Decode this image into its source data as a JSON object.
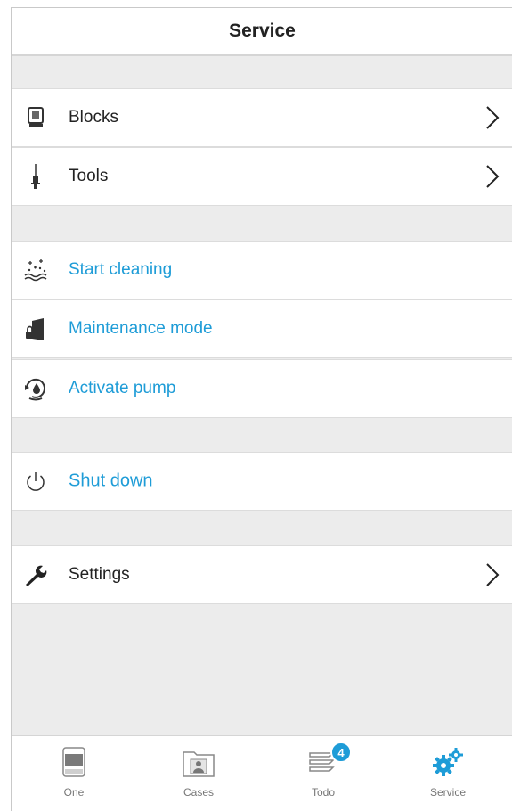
{
  "header": {
    "title": "Service"
  },
  "menu": {
    "blocks": {
      "label": "Blocks",
      "icon": "block-cassette-icon"
    },
    "tools": {
      "label": "Tools",
      "icon": "tool-needle-icon"
    },
    "start_cleaning": {
      "label": "Start cleaning",
      "icon": "cleaning-sparkle-icon"
    },
    "maintenance_mode": {
      "label": "Maintenance mode",
      "icon": "maintenance-lock-icon"
    },
    "activate_pump": {
      "label": "Activate pump",
      "icon": "pump-drop-icon"
    },
    "shut_down": {
      "label": "Shut down",
      "icon": "power-icon"
    },
    "settings": {
      "label": "Settings",
      "icon": "wrench-icon"
    }
  },
  "tabs": {
    "one": {
      "label": "One",
      "icon": "device-icon"
    },
    "cases": {
      "label": "Cases",
      "icon": "cases-folder-icon"
    },
    "todo": {
      "label": "Todo",
      "icon": "todo-stack-icon",
      "badge": "4"
    },
    "service": {
      "label": "Service",
      "icon": "gears-icon"
    }
  },
  "colors": {
    "accent": "#1e9cd7",
    "text": "#222222",
    "background": "#ececec"
  }
}
